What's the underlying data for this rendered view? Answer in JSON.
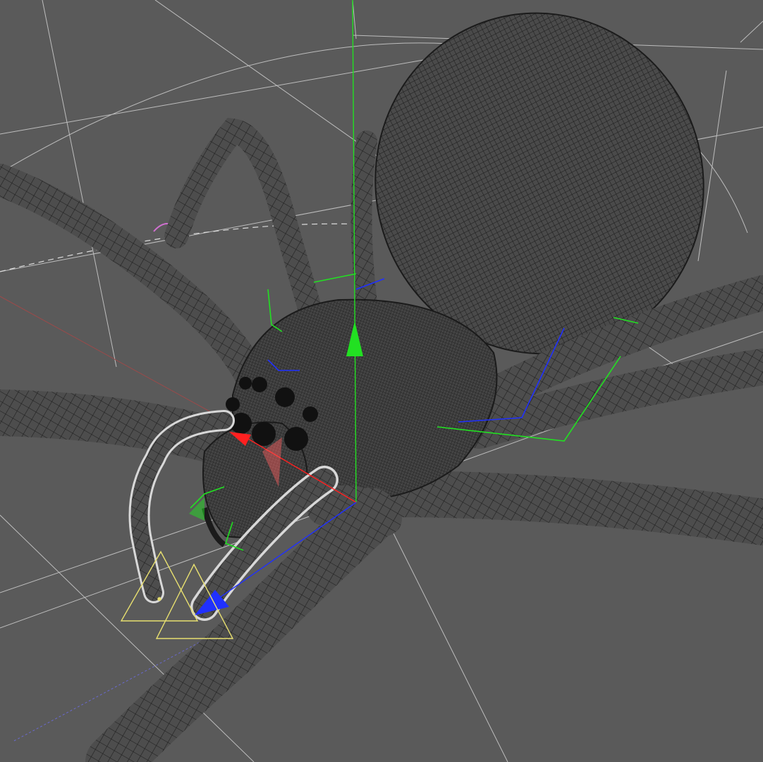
{
  "viewport": {
    "kind": "3d-viewport",
    "subject": "spider-mesh",
    "background_color": "#5a5a5a",
    "mesh_fill_color": "#4a4a4a",
    "mesh_wire_color": "#1b1b1b",
    "selected_wire_color": "#d8d8d8",
    "gizmo": {
      "x_color": "#ff2020",
      "y_color": "#22e022",
      "z_color": "#2030ff"
    },
    "guide_colors": {
      "grid": "#cfcfcf",
      "camera_frustum": "#e8e070",
      "light_marker": "#e8e070",
      "pivot_arc": "#d070d0"
    }
  }
}
